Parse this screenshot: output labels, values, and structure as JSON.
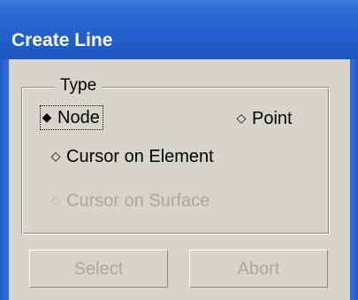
{
  "window": {
    "title": "Create Line",
    "titlebar_color": "#2562cf",
    "background_color": "#d6d4cb"
  },
  "type_group": {
    "legend": "Type",
    "options": [
      {
        "label": "Node",
        "selected": true,
        "enabled": true,
        "focused": true,
        "icon": "radio-selected-icon"
      },
      {
        "label": "Point",
        "selected": false,
        "enabled": true,
        "icon": "radio-unselected-icon"
      },
      {
        "label": "Cursor on Element",
        "selected": false,
        "enabled": true,
        "icon": "radio-unselected-icon"
      },
      {
        "label": "Cursor on Surface",
        "selected": false,
        "enabled": false,
        "icon": "radio-unselected-icon"
      }
    ]
  },
  "buttons": {
    "select_label": "Select",
    "abort_label": "Abort",
    "enabled": false
  }
}
